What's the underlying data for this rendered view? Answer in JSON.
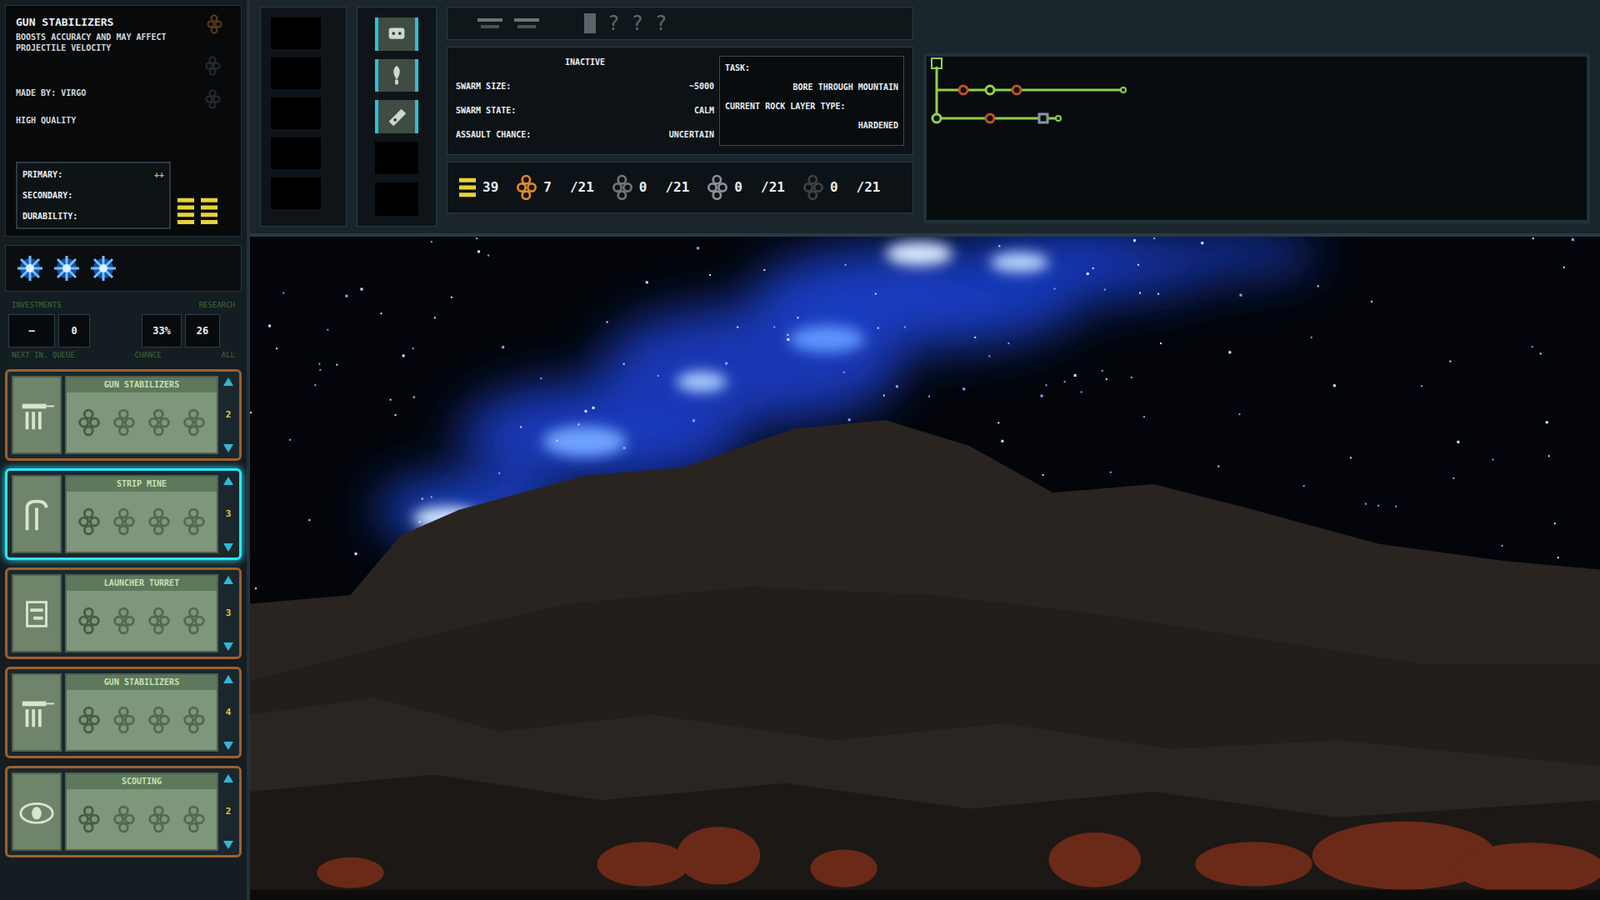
{
  "detail": {
    "title": "GUN STABILIZERS",
    "description": "BOOSTS ACCURACY AND MAY AFFECT PROJECTILE VELOCITY",
    "maker": "MADE BY: VIRGO",
    "quality": "HIGH QUALITY",
    "stats": [
      {
        "label": "PRIMARY:",
        "value": "++"
      },
      {
        "label": "SECONDARY:"
      },
      {
        "label": "DURABILITY:"
      }
    ],
    "durability_bars": 2
  },
  "module_slots": 3,
  "investments": {
    "labels_top": [
      "INVESTMENTS",
      "RESEARCH"
    ],
    "values": [
      "—",
      "0",
      "33%",
      "26"
    ],
    "labels_bottom": [
      "NEXT IN. QUEUE",
      "CHANCE",
      "ALL"
    ]
  },
  "queue": [
    {
      "title": "GUN STABILIZERS",
      "count": "2",
      "selected": false,
      "kind": "gun"
    },
    {
      "title": "STRIP MINE",
      "count": "3",
      "selected": true,
      "kind": "mine"
    },
    {
      "title": "LAUNCHER TURRET",
      "count": "3",
      "selected": false,
      "kind": "turret"
    },
    {
      "title": "GUN STABILIZERS",
      "count": "4",
      "selected": false,
      "kind": "gun"
    },
    {
      "title": "SCOUTING",
      "count": "2",
      "selected": false,
      "kind": "eye"
    }
  ],
  "status": {
    "marks": [
      "?",
      "?",
      "?"
    ],
    "state": "INACTIVE",
    "fields": [
      {
        "label": "SWARM SIZE:",
        "value": "~5000"
      },
      {
        "label": "SWARM STATE:",
        "value": "CALM"
      },
      {
        "label": "ASSAULT CHANCE:",
        "value": "UNCERTAIN"
      }
    ],
    "task_label": "TASK:",
    "task": "BORE THROUGH MOUNTAIN",
    "rock_label": "CURRENT ROCK LAYER TYPE:",
    "rock": "HARDENED"
  },
  "resources": [
    {
      "value": "39",
      "kind": "bars",
      "color": "#e8d23a"
    },
    {
      "value": "7",
      "max": "/21",
      "kind": "cluster",
      "color": "#e0892a"
    },
    {
      "value": "0",
      "max": "/21",
      "kind": "cluster",
      "color": "#6f7478"
    },
    {
      "value": "0",
      "max": "/21",
      "kind": "cluster",
      "color": "#8a9096"
    },
    {
      "value": "0",
      "max": "/21",
      "kind": "cluster",
      "color": "#3e4244"
    }
  ],
  "tree": {
    "branches": [
      {
        "nodes": [
          {
            "color": "#c2502a",
            "kind": "circle"
          },
          {
            "color": "#9ad04a",
            "kind": "circle"
          },
          {
            "color": "#c2502a",
            "kind": "circle"
          }
        ]
      },
      {
        "nodes": [
          {
            "color": "#9ad04a",
            "kind": "circle"
          },
          {
            "color": "#c2502a",
            "kind": "circle"
          },
          {
            "color": "#8a96a0",
            "kind": "square"
          }
        ]
      }
    ]
  }
}
